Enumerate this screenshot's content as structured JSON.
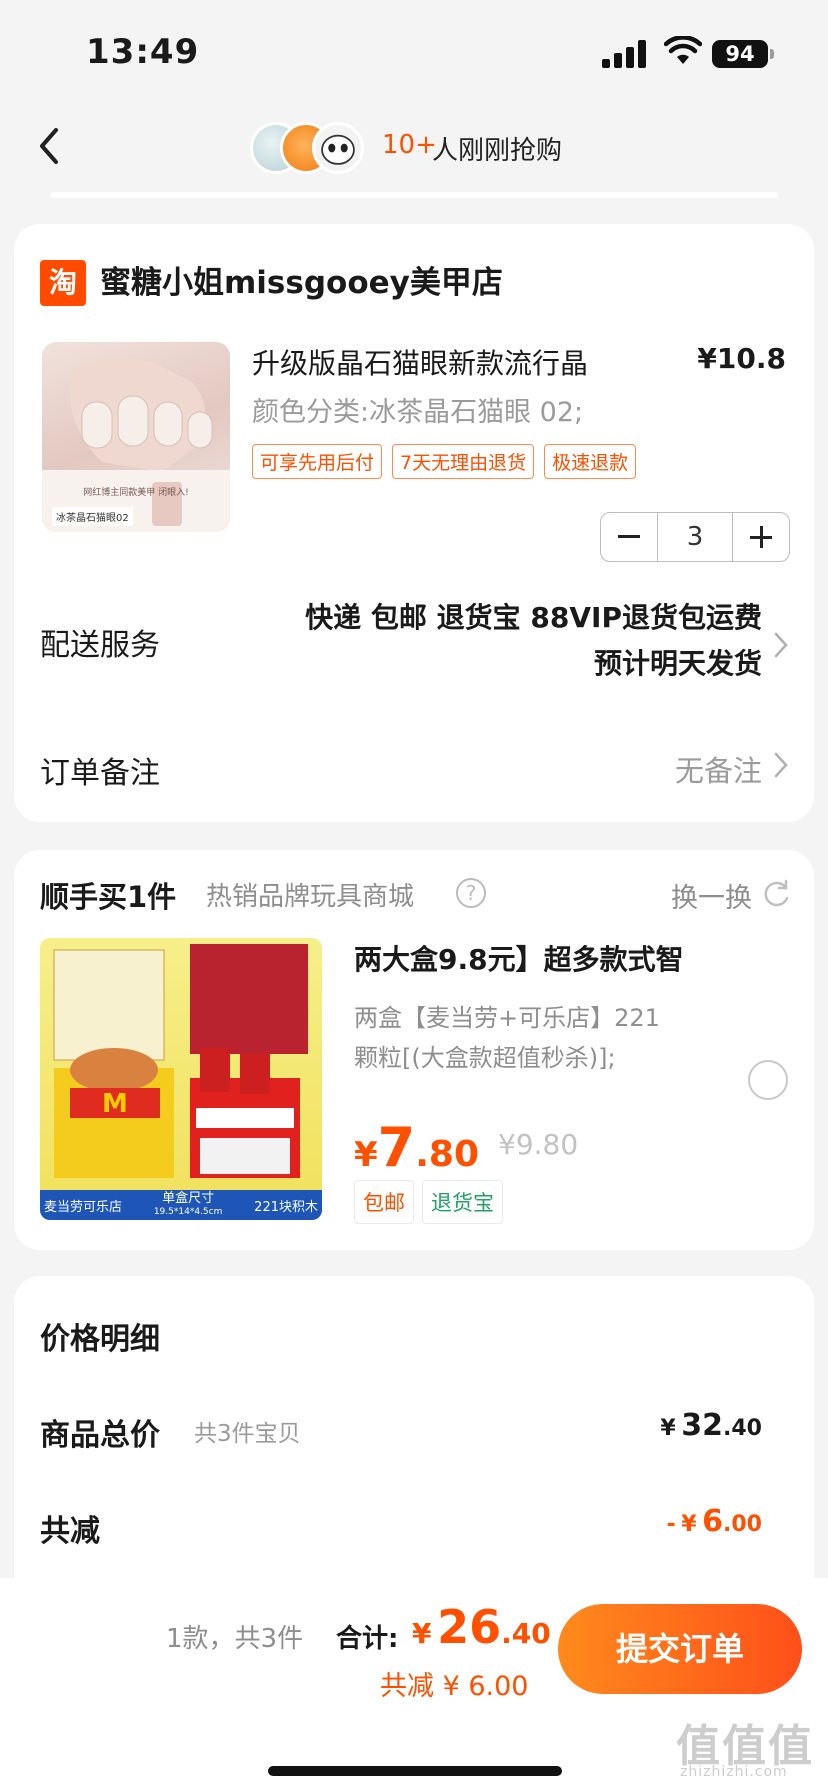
{
  "status_bar": {
    "time": "13:49",
    "battery": "94"
  },
  "nav": {
    "buyer_count": "10+",
    "buyer_text": "人刚刚抢购"
  },
  "shop": {
    "logo": "淘",
    "name": "蜜糖小姐missgooey美甲店",
    "product": {
      "title": "升级版晶石猫眼新款流行晶",
      "price": "¥10.8",
      "spec": "颜色分类:冰茶晶石猫眼 02;",
      "tags": [
        "可享先用后付",
        "7天无理由退货",
        "极速退款"
      ],
      "quantity": "3",
      "image_caption_1": "网红博主同款美甲 闭眼入!",
      "image_caption_2": "冰茶晶石猫眼02"
    },
    "delivery": {
      "label": "配送服务",
      "line1": "快递 包邮 退货宝 88VIP退货包运费",
      "line2": "预计明天发货"
    },
    "note": {
      "label": "订单备注",
      "value": "无备注"
    }
  },
  "recommend": {
    "title": "顺手买1件",
    "subtitle": "热销品牌玩具商城",
    "swap_label": "换一换",
    "item": {
      "name": "两大盒9.8元】超多款式智",
      "desc_line1": "两盒【麦当劳+可乐店】221",
      "desc_line2": "颗粒[(大盒款超值秒杀)];",
      "price_currency": "¥",
      "price_int": "7",
      "price_dec": ".80",
      "old_price": "¥9.80",
      "tags": [
        "包邮",
        "退货宝"
      ],
      "image_label_left": "麦当劳可乐店",
      "image_label_mid": "单盒尺寸",
      "image_label_mid2": "19.5*14*4.5cm",
      "image_label_right": "221块积木"
    }
  },
  "price_detail": {
    "title": "价格明细",
    "goods_total_label": "商品总价",
    "goods_total_note": "共3件宝贝",
    "goods_total_currency": "¥",
    "goods_total_int": "32",
    "goods_total_dec": ".40",
    "discount_label": "共减",
    "discount_prefix": "-",
    "discount_currency": "¥",
    "discount_int": "6",
    "discount_dec": ".00"
  },
  "bottom_bar": {
    "count_text": "1款，共3件",
    "total_label": "合计:",
    "total_currency": "¥",
    "total_int": "26",
    "total_dec": ".40",
    "discount_text": "共减 ¥ 6.00",
    "submit_label": "提交订单"
  },
  "watermark": {
    "main": "值值值",
    "sub": "zhizhizhi.com"
  },
  "colors": {
    "accent": "#ff5000",
    "bg": "#f4f4f4",
    "green_tag": "#26a069"
  }
}
